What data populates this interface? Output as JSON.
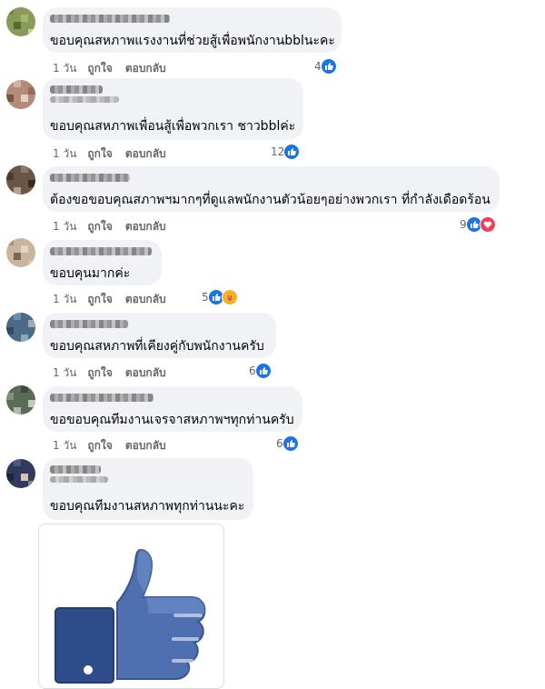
{
  "actions": {
    "time": "1 วัน",
    "like": "ถูกใจ",
    "reply": "ตอบกลับ"
  },
  "comments": [
    {
      "text": "ขอบคุณสหภาพแรงงานที่ช่วยสู้เพื่อพนักงานbblนะคะ",
      "reactions": "4",
      "types": [
        "like"
      ]
    },
    {
      "text": "ขอบคุณสหภาพเพื่อนสู้เพื่อพวกเรา ชาวbblค่ะ",
      "reactions": "12",
      "types": [
        "like"
      ]
    },
    {
      "text": "ต้องขอขอบคุณสภาพฯมากๆที่ดูแลพนักงานตัวน้อยๆอย่างพวกเรา ที่กำลังเดือดร้อน",
      "reactions": "9",
      "types": [
        "like",
        "love"
      ]
    },
    {
      "text": "ขอบคุนมากค่ะ",
      "reactions": "5",
      "types": [
        "like",
        "care"
      ]
    },
    {
      "text": "ขอบคุณสหภาพที่เคียงคู่กับพนักงานครับ",
      "reactions": "6",
      "types": [
        "like"
      ]
    },
    {
      "text": "ขอขอบคุณทีมงานเจรจาสหภาพฯทุกท่านครับ",
      "reactions": "6",
      "types": [
        "like"
      ]
    },
    {
      "text": "ขอบคุณทีมงานสหภาพทุกท่านนะคะ",
      "reactions": "",
      "types": []
    }
  ],
  "colors": {
    "like": "#1b74e4",
    "love": "#f33e58",
    "care": "#f7b125",
    "bubble": "#f0f2f5"
  },
  "sticker": {
    "icon": "thumbs-up-icon"
  }
}
